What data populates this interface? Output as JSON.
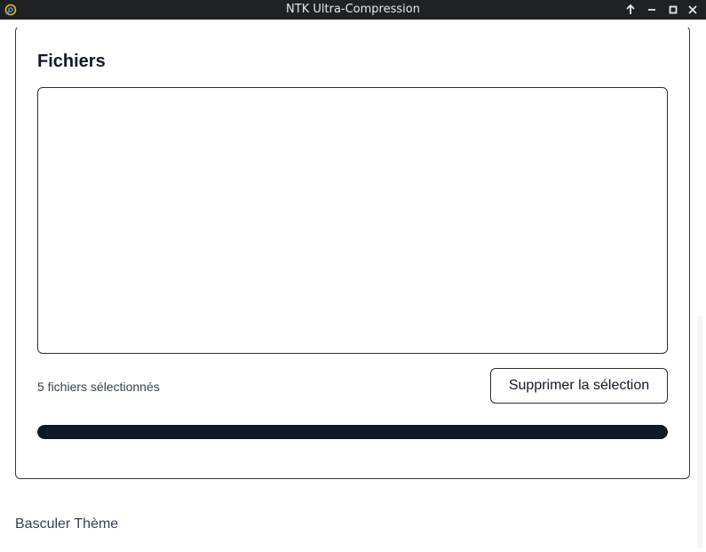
{
  "window": {
    "title": "NTK Ultra-Compression"
  },
  "files_card": {
    "title": "Fichiers",
    "selected_count_text": "5 fichiers sélectionnés",
    "clear_button_label": "Supprimer la sélection",
    "progress": 1.0
  },
  "footer": {
    "theme_toggle_label": "Basculer Thème"
  },
  "colors": {
    "titlebar_bg": "#1f2125",
    "progress_fill": "#111827",
    "app_icon_accent": "#f5b800"
  },
  "icons": {
    "app": "app-logo-icon",
    "up": "arrow-up-icon",
    "minimize": "minimize-icon",
    "maximize": "maximize-icon",
    "close": "close-icon"
  }
}
